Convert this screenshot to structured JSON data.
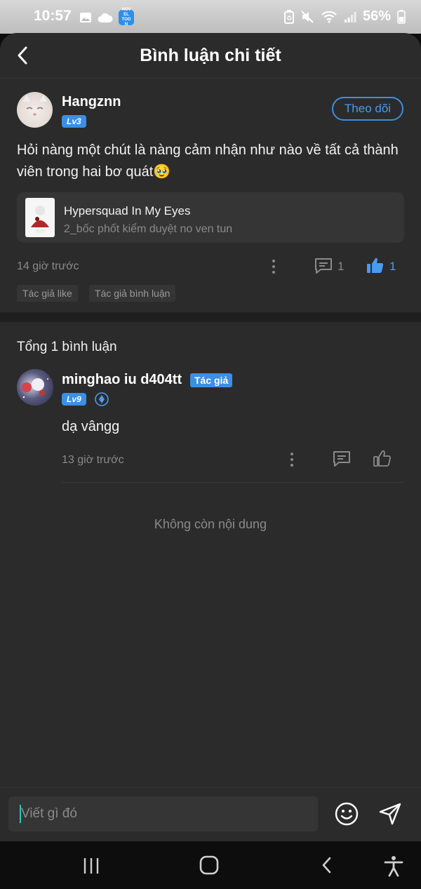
{
  "status_bar": {
    "time": "10:57",
    "battery_percent": "56%",
    "app_notification_label": "NOVEL TOON"
  },
  "header": {
    "title": "Bình luận chi tiết"
  },
  "post": {
    "username": "Hangznn",
    "level": "Lv3",
    "follow_label": "Theo dõi",
    "text": "Hỏi nàng một chút là nàng cảm nhận như nào về tất cả thành viên trong hai bơ quát🥹",
    "book": {
      "title": "Hypersquad In My Eyes",
      "chapter": "2_bốc phốt kiểm duyệt no ven tun"
    },
    "time": "14 giờ trước",
    "comment_count": "1",
    "like_count": "1",
    "tags": [
      "Tác giả like",
      "Tác giả bình luận"
    ]
  },
  "comments": {
    "total_label": "Tổng 1 bình luận",
    "items": [
      {
        "username": "minghao iu d404tt",
        "author_label": "Tác giả",
        "level": "Lv9",
        "text": "dạ vângg",
        "time": "13 giờ trước"
      }
    ],
    "end_label": "Không còn nội dung"
  },
  "composer": {
    "placeholder": "Viết gì đó"
  },
  "colors": {
    "accent": "#3b8fe5",
    "background": "#2b2b2b",
    "card": "#353535",
    "muted_text": "#8a8a8a"
  },
  "icons": {
    "back": "chevron-left-icon",
    "more": "more-vertical-icon",
    "comment": "comment-icon",
    "like": "thumbs-up-icon",
    "emoji": "emoji-icon",
    "send": "send-icon",
    "diamond": "diamond-icon"
  }
}
